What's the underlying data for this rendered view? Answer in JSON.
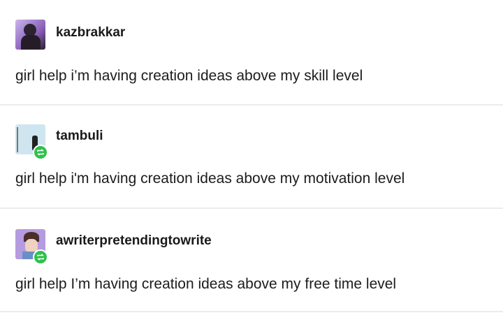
{
  "posts": [
    {
      "username": "kazbrakkar",
      "text": "girl help i’m having creation ideas above my skill level",
      "reblog": false
    },
    {
      "username": "tambuli",
      "text": "girl help i'm having creation ideas above my motivation level",
      "reblog": true
    },
    {
      "username": "awriterpretendingtowrite",
      "text": "girl help I’m having creation ideas above my free time level",
      "reblog": true
    }
  ],
  "colors": {
    "reblog_badge": "#2fc14c",
    "divider": "#ececec"
  }
}
